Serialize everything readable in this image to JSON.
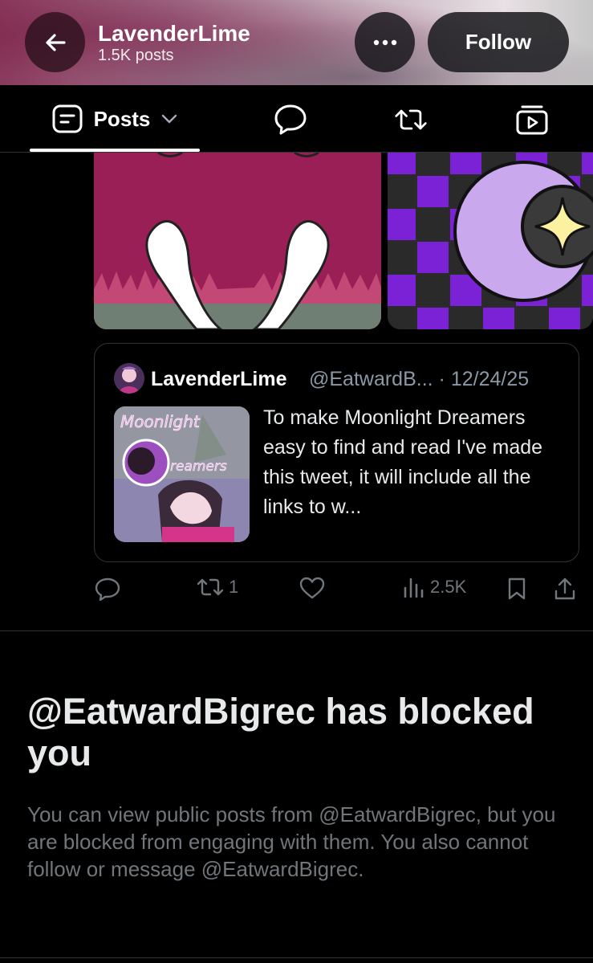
{
  "header": {
    "title": "LavenderLime",
    "subtitle": "1.5K posts",
    "follow_label": "Follow"
  },
  "tabs": [
    {
      "label": "Posts",
      "icon": "posts-icon",
      "active": true
    },
    {
      "label": "",
      "icon": "reply-bubble-icon"
    },
    {
      "label": "",
      "icon": "repost-icon"
    },
    {
      "label": "",
      "icon": "media-play-icon"
    }
  ],
  "quote": {
    "name": "LavenderLime",
    "handle": "@EatwardB... · 12/24/25",
    "text": "To make Moonlight Dreamers easy to find and read I've made this tweet, it will include all the links to w...",
    "thumb_title": "Moonlight Dreamers"
  },
  "actions": {
    "reposts": "1",
    "views": "2.5K"
  },
  "blocked": {
    "title": "@EatwardBigrec has blocked you",
    "description": "You can view public posts from @EatwardBigrec, but you are blocked from engaging with them. You also cannot follow or message @EatwardBigrec."
  },
  "colors": {
    "background": "#000000",
    "text": "#e7e9ea",
    "secondary_text": "#71767b",
    "border": "#2f3336"
  }
}
